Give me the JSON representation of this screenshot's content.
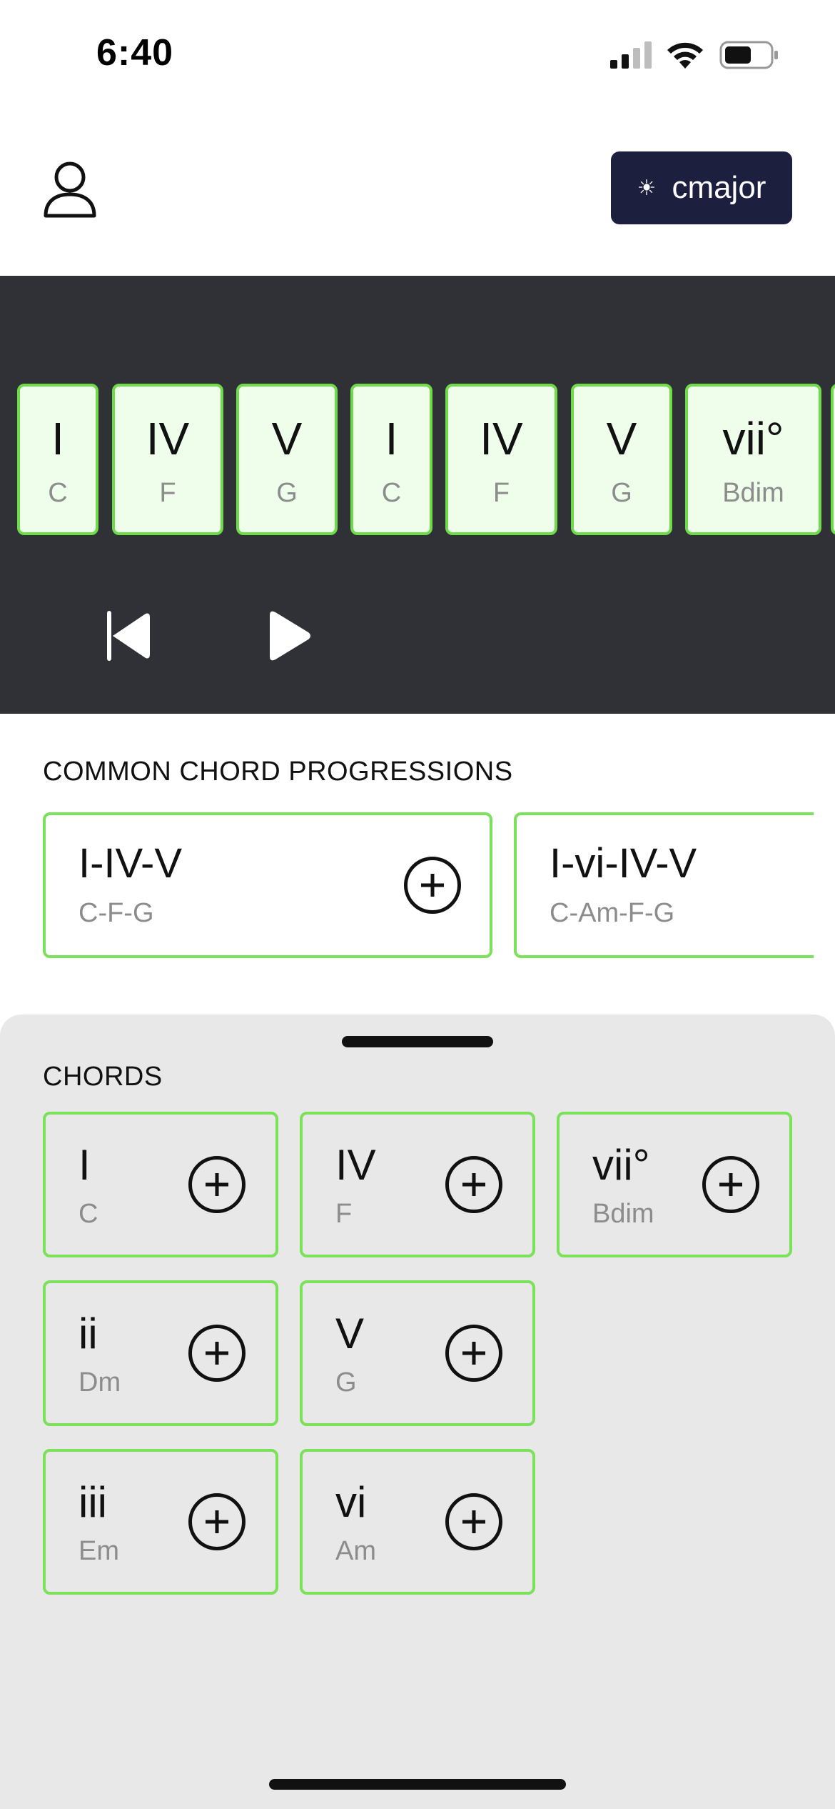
{
  "status": {
    "time": "6:40"
  },
  "header": {
    "key_label": "cmajor",
    "key_icon": "sun-icon"
  },
  "timeline": {
    "cards": [
      {
        "numeral": "I",
        "name": "C"
      },
      {
        "numeral": "IV",
        "name": "F"
      },
      {
        "numeral": "V",
        "name": "G"
      },
      {
        "numeral": "I",
        "name": "C"
      },
      {
        "numeral": "IV",
        "name": "F"
      },
      {
        "numeral": "V",
        "name": "G"
      },
      {
        "numeral": "vii°",
        "name": "Bdim"
      }
    ]
  },
  "progressions": {
    "title": "COMMON CHORD PROGRESSIONS",
    "items": [
      {
        "title": "I-IV-V",
        "chords": "C-F-G"
      },
      {
        "title": "I-vi-IV-V",
        "chords": "C-Am-F-G"
      }
    ]
  },
  "chords": {
    "title": "CHORDS",
    "items": [
      {
        "numeral": "I",
        "name": "C"
      },
      {
        "numeral": "IV",
        "name": "F"
      },
      {
        "numeral": "vii°",
        "name": "Bdim"
      },
      {
        "numeral": "ii",
        "name": "Dm"
      },
      {
        "numeral": "V",
        "name": "G"
      },
      {
        "numeral": "iii",
        "name": "Em"
      },
      {
        "numeral": "vi",
        "name": "Am"
      }
    ]
  },
  "colors": {
    "accent_green": "#7be05a",
    "card_fill": "#eefeea",
    "timeline_bg": "#303136",
    "key_button_bg": "#1d1f3f",
    "sheet_bg": "#e8e8e8"
  }
}
